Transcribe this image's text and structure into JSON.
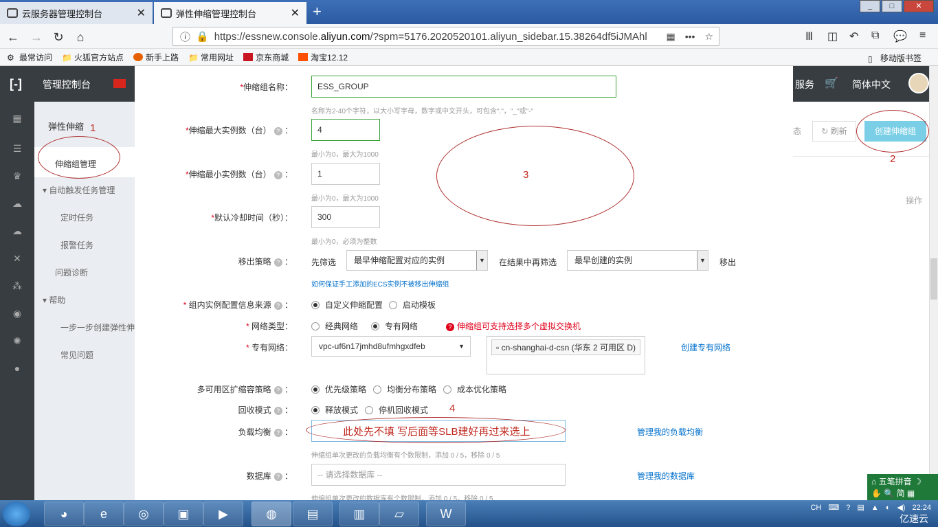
{
  "browser": {
    "tabs": [
      {
        "label": "云服务器管理控制台",
        "close": "✕"
      },
      {
        "label": "弹性伸缩管理控制台",
        "close": "✕"
      }
    ],
    "new_tab": "+",
    "url_prefix": "https://essnew.console.",
    "url_domain": "aliyun.com",
    "url_rest": "/?spm=5176.2020520101.aliyun_sidebar.15.38264df5iJMAhl",
    "bookmarks": [
      "最常访问",
      "火狐官方站点",
      "新手上路",
      "常用网址",
      "京东商城",
      "淘宝12.12"
    ],
    "mobile_bookmarks": "移动版书签"
  },
  "console": {
    "logo": "[-]",
    "title": "管理控制台",
    "services": "服务",
    "lang": "简体中文"
  },
  "sidenav": {
    "title": "弹性伸缩",
    "items": [
      "伸缩组管理",
      "自动触发任务管理",
      "定时任务",
      "报警任务",
      "问题诊断",
      "帮助",
      "一步一步创建弹性伸",
      "常见问题"
    ]
  },
  "main": {
    "status_trunc": "态",
    "refresh": "刷新",
    "create": "创建伸缩组",
    "op_col": "操作"
  },
  "form": {
    "name_label": "伸缩组名称：",
    "name_value": "ESS_GROUP",
    "name_help": "名称为2-40个字符，以大小写字母，数字或中文开头，可包含\".\"，\"_\"或\"-\"",
    "max_label": "伸缩最大实例数（台）",
    "max_value": "4",
    "max_help": "最小为0，最大为1000",
    "min_label": "伸缩最小实例数（台）",
    "min_value": "1",
    "min_help": "最小为0，最大为1000",
    "cool_label": "默认冷却时间（秒）：",
    "cool_value": "300",
    "cool_help": "最小为0，必须为整数",
    "remove_label": "移出策略",
    "first_filter": "先筛选",
    "first_select": "最早伸缩配置对应的实例",
    "then_filter": "在结果中再筛选",
    "then_select": "最早创建的实例",
    "remove_suffix": "移出",
    "ecs_link": "如何保证手工添加的ECS实例不被移出伸缩组",
    "source_label": "组内实例配置信息来源",
    "source_opt1": "自定义伸缩配置",
    "source_opt2": "启动模板",
    "net_label": "网络类型：",
    "net_opt1": "经典网络",
    "net_opt2": "专有网络",
    "net_warn": "伸缩组可支持选择多个虚拟交换机",
    "vpc_label": "专有网络：",
    "vpc_value": "vpc-uf6n17jmhd8ufmhgxdfeb",
    "vsw_chip": "cn-shanghai-d-csn (华东 2 可用区 D)",
    "vpc_link": "创建专有网络",
    "az_label": "多可用区扩缩容策略",
    "az_opt1": "优先级策略",
    "az_opt2": "均衡分布策略",
    "az_opt3": "成本优化策略",
    "recycle_label": "回收模式",
    "recycle_opt1": "释放模式",
    "recycle_opt2": "停机回收模式",
    "slb_label": "负载均衡",
    "slb_link": "管理我的负载均衡",
    "slb_help": "伸缩组单次更改的负载均衡有个数限制，添加 0 / 5，移除 0 / 5",
    "db_label": "数据库",
    "db_placeholder": "-- 请选择数据库 --",
    "db_link": "管理我的数据库",
    "db_help": "伸缩组单次更改的数据库有个数限制，添加 0 / 5，移除 0 / 5"
  },
  "annotations": {
    "n1": "1",
    "n2": "2",
    "n3": "3",
    "n4": "4",
    "slb_note": "此处先不填 写后面等SLB建好再过来选上"
  },
  "taskbar": {
    "ime": "五笔拼音",
    "ime2": "简",
    "tray_lang": "CH",
    "watermark": "亿速云",
    "clock": "22:24"
  },
  "colors": {
    "accent": "#7acfe6",
    "annotation": "#c0281e",
    "link": "#0070cc"
  }
}
